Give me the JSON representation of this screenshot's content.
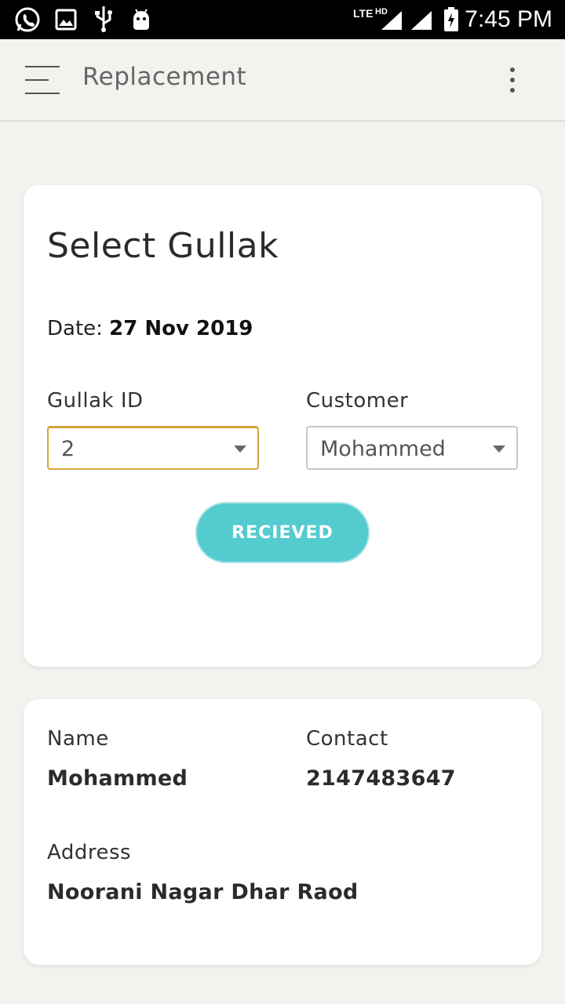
{
  "status_bar": {
    "time": "7:45 PM",
    "left_icons": [
      "whatsapp-icon",
      "image-icon",
      "usb-icon",
      "android-icon"
    ],
    "right_icons": [
      "lte-icon",
      "hd-signal-icon",
      "signal-icon",
      "battery-charging-icon"
    ],
    "network_label": "LTE",
    "hd_label": "HD"
  },
  "app_bar": {
    "title": "Replacement"
  },
  "select_card": {
    "title": "Select Gullak",
    "date_label": "Date:",
    "date_value": "27 Nov 2019",
    "gullak_id_label": "Gullak ID",
    "gullak_id_value": "2",
    "customer_label": "Customer",
    "customer_value": "Mohammed",
    "button_label": "RECIEVED"
  },
  "info_card": {
    "name_label": "Name",
    "name_value": "Mohammed",
    "contact_label": "Contact",
    "contact_value": "2147483647",
    "address_label": "Address",
    "address_value": "Noorani Nagar Dhar Raod"
  },
  "colors": {
    "accent_button": "#54cbcf",
    "focus_border": "#d4a63a",
    "background": "#f3f2ef"
  }
}
